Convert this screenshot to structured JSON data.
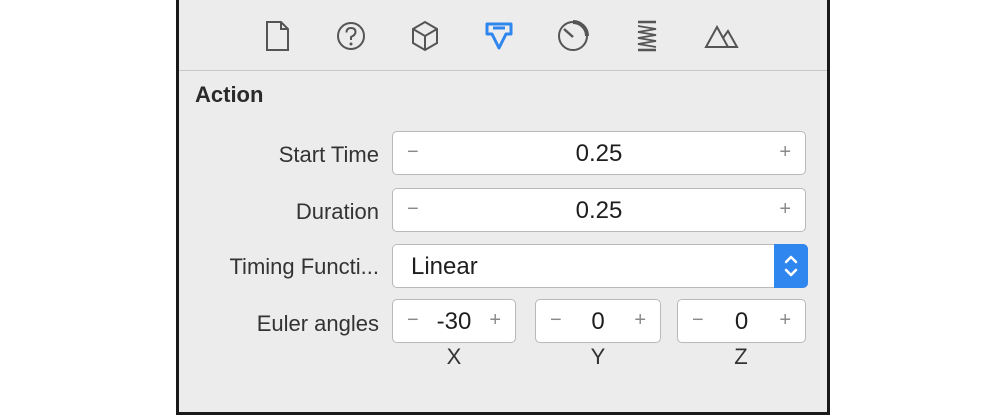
{
  "toolbar": {
    "icons": [
      {
        "name": "file-icon"
      },
      {
        "name": "help-icon"
      },
      {
        "name": "cube-icon"
      },
      {
        "name": "action-icon",
        "selected": true
      },
      {
        "name": "dial-icon"
      },
      {
        "name": "spring-icon"
      },
      {
        "name": "mountain-icon"
      }
    ],
    "accent_color": "#2f86ee"
  },
  "section": {
    "title": "Action"
  },
  "start_time": {
    "label": "Start Time",
    "value": "0.25",
    "minus": "−",
    "plus": "+"
  },
  "duration": {
    "label": "Duration",
    "value": "0.25",
    "minus": "−",
    "plus": "+"
  },
  "timing_function": {
    "label": "Timing Functi...",
    "selected": "Linear"
  },
  "euler_angles": {
    "label": "Euler angles",
    "x": {
      "value": "-30",
      "axis": "X",
      "minus": "−",
      "plus": "+"
    },
    "y": {
      "value": "0",
      "axis": "Y",
      "minus": "−",
      "plus": "+"
    },
    "z": {
      "value": "0",
      "axis": "Z",
      "minus": "−",
      "plus": "+"
    }
  }
}
